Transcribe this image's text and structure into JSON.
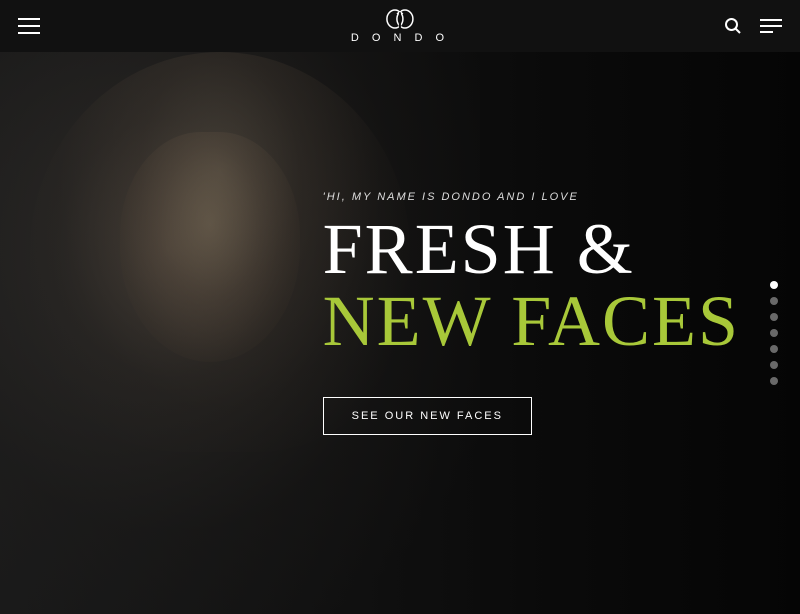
{
  "header": {
    "logo_text": "D O N D O",
    "logo_icon_label": "DD"
  },
  "hero": {
    "subtitle": "'HI, MY NAME IS DONDO AND I LOVE",
    "title_line1": "FRESH &",
    "title_line2": "NEW FACES",
    "cta_label": "SEE OUR NEW FACES"
  },
  "dot_nav": {
    "dots": [
      {
        "id": 1,
        "active": true
      },
      {
        "id": 2,
        "active": false
      },
      {
        "id": 3,
        "active": false
      },
      {
        "id": 4,
        "active": false
      },
      {
        "id": 5,
        "active": false
      },
      {
        "id": 6,
        "active": false
      },
      {
        "id": 7,
        "active": false
      }
    ]
  },
  "icons": {
    "hamburger_left": "☰",
    "search": "search",
    "hamburger_right": "≡"
  }
}
